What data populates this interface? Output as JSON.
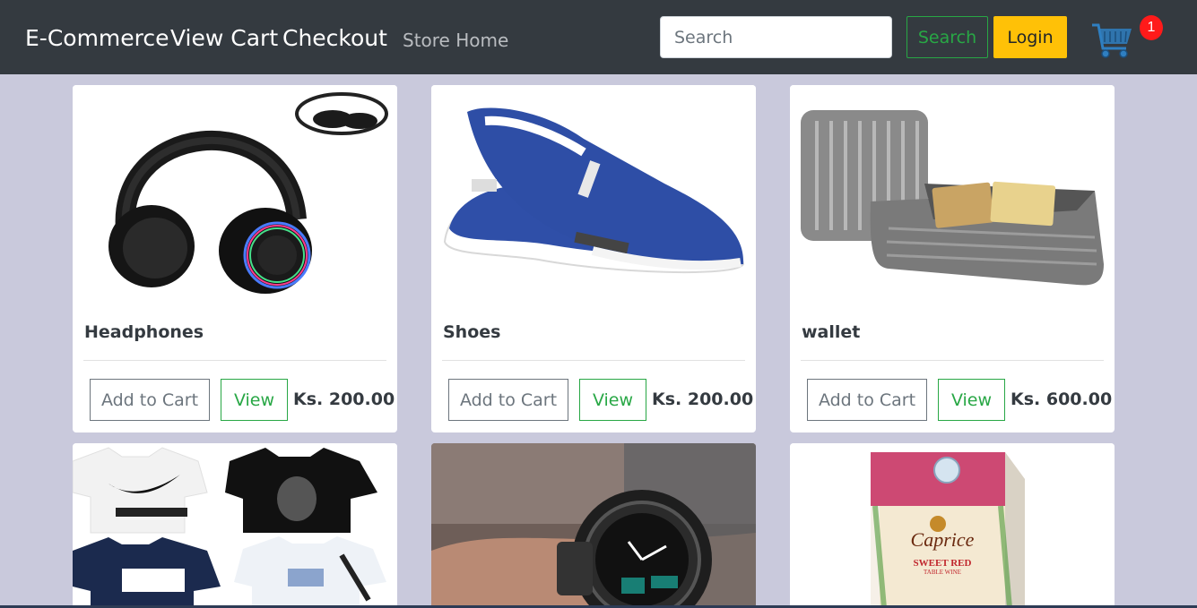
{
  "nav": {
    "brand": "E-Commerce",
    "view_cart": "View Cart",
    "checkout": "Checkout",
    "store_home": "Store Home",
    "search_placeholder": "Search",
    "search_button": "Search",
    "login_button": "Login",
    "cart_count": "1"
  },
  "products": [
    {
      "name": "Headphones",
      "price": "Ks. 200.00",
      "add_label": "Add to Cart",
      "view_label": "View"
    },
    {
      "name": "Shoes",
      "price": "Ks. 200.00",
      "add_label": "Add to Cart",
      "view_label": "View"
    },
    {
      "name": "wallet",
      "price": "Ks. 600.00",
      "add_label": "Add to Cart",
      "view_label": "View"
    }
  ],
  "lower_products_icons": [
    "tshirts-image",
    "watch-image",
    "wine-box-image"
  ],
  "wine_label": {
    "brand": "Caprice",
    "line1": "SWEET RED",
    "line2": "TABLE WINE"
  },
  "colors": {
    "navbar": "#343a40",
    "background": "#c9c9dc",
    "success": "#28a745",
    "warning": "#ffc107",
    "badge": "#ff1a1a"
  }
}
